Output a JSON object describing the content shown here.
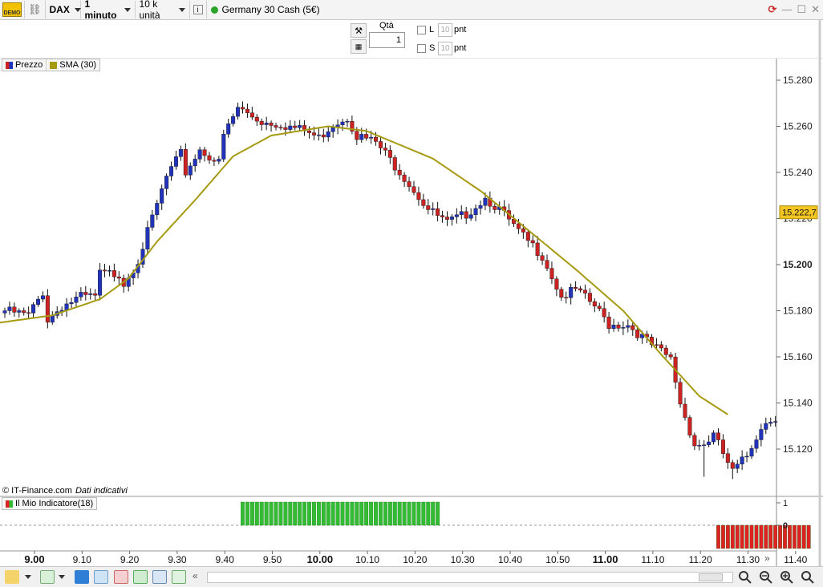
{
  "toolbar": {
    "demo_badge": "DEMO",
    "instrument": "DAX",
    "timeframe": "1 minuto",
    "units": "10 k unità",
    "info": "i",
    "market_name": "Germany 30 Cash (5€)"
  },
  "order_panel": {
    "qty_label": "Qtà",
    "qty_value": "1",
    "long_label": "L",
    "short_label": "S",
    "long_points": "10",
    "short_points": "10",
    "points_unit": "pnt"
  },
  "legend": {
    "price_label": "Prezzo",
    "sma_label": "SMA (30)",
    "price_color": "#2233bb",
    "sma_color": "#a69a10"
  },
  "copyright": {
    "source": "© IT-Finance.com",
    "note": "Dati indicativi"
  },
  "indicator": {
    "label": "Il Mio Indicatore(18)",
    "ticks": [
      "1",
      "0"
    ],
    "positive_color": "#33bb33",
    "negative_color": "#dd2222",
    "positive_range": [
      "9.50",
      "10.31"
    ],
    "negative_range": [
      "11.30",
      "11.49"
    ]
  },
  "nav": {
    "expand": "»"
  },
  "chart_data": {
    "type": "candlestick",
    "instrument": "Germany 30 Cash (5€)",
    "timeframe": "1 minuto",
    "x_ticks": [
      "9.00",
      "9.10",
      "9.20",
      "9.30",
      "9.40",
      "9.50",
      "10.00",
      "10.10",
      "10.20",
      "10.30",
      "10.40",
      "10.50",
      "11.00",
      "11.10",
      "11.20",
      "11.30",
      "11.40"
    ],
    "x_ticks_bold": [
      "9.00",
      "10.00",
      "11.00"
    ],
    "y_ticks": [
      "15.280",
      "15.260",
      "15.240",
      "15.220",
      "15.200",
      "15.180",
      "15.160",
      "15.140",
      "15.120"
    ],
    "y_ticks_bold": [
      "15.200"
    ],
    "ylim": [
      15100,
      15288
    ],
    "last_price": "15.222,7",
    "colors": {
      "up": "#2233bb",
      "down": "#cc2222",
      "sma": "#a69a10"
    },
    "close_path": [
      [
        0,
        15180
      ],
      [
        5,
        15178
      ],
      [
        8,
        15188
      ],
      [
        9,
        15176
      ],
      [
        12,
        15182
      ],
      [
        16,
        15186
      ],
      [
        19,
        15186
      ],
      [
        20,
        15196
      ],
      [
        24,
        15196
      ],
      [
        25,
        15192
      ],
      [
        28,
        15202
      ],
      [
        32,
        15226
      ],
      [
        34,
        15238
      ],
      [
        37,
        15248
      ],
      [
        38,
        15240
      ],
      [
        41,
        15250
      ],
      [
        45,
        15244
      ],
      [
        46,
        15256
      ],
      [
        49,
        15268
      ],
      [
        54,
        15262
      ],
      [
        58,
        15261
      ],
      [
        63,
        15258
      ],
      [
        66,
        15255
      ],
      [
        69,
        15261
      ],
      [
        72,
        15264
      ],
      [
        74,
        15256
      ],
      [
        78,
        15253
      ],
      [
        84,
        15238
      ],
      [
        89,
        15224
      ],
      [
        93,
        15218
      ],
      [
        97,
        15222
      ],
      [
        101,
        15229
      ],
      [
        104,
        15224
      ],
      [
        108,
        15214
      ],
      [
        113,
        15204
      ],
      [
        117,
        15186
      ],
      [
        120,
        15189
      ],
      [
        124,
        15182
      ],
      [
        127,
        15174
      ],
      [
        131,
        15174
      ],
      [
        136,
        15165
      ],
      [
        140,
        15159
      ],
      [
        142,
        15140
      ],
      [
        145,
        15122
      ],
      [
        147,
        15122
      ],
      [
        149,
        15126
      ],
      [
        153,
        15110
      ],
      [
        156,
        15117
      ],
      [
        159,
        15130
      ],
      [
        162,
        15134
      ]
    ],
    "sma_path": [
      [
        -4,
        15174
      ],
      [
        10,
        15178
      ],
      [
        20,
        15185
      ],
      [
        26,
        15194
      ],
      [
        32,
        15210
      ],
      [
        40,
        15228
      ],
      [
        48,
        15247
      ],
      [
        56,
        15256
      ],
      [
        68,
        15260
      ],
      [
        76,
        15258
      ],
      [
        90,
        15246
      ],
      [
        100,
        15232
      ],
      [
        110,
        15215
      ],
      [
        120,
        15198
      ],
      [
        130,
        15180
      ],
      [
        138,
        15161
      ],
      [
        146,
        15143
      ],
      [
        152,
        15135
      ]
    ],
    "wick_extremes": [
      [
        9,
        15174
      ],
      [
        49,
        15270
      ],
      [
        147,
        15108
      ],
      [
        153,
        15107
      ]
    ]
  }
}
